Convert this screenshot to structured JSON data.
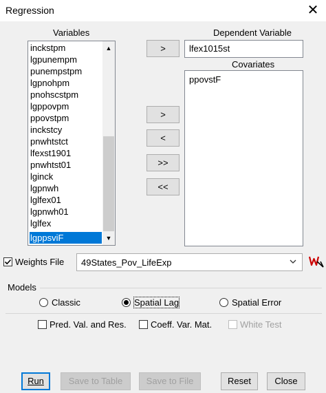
{
  "window": {
    "title": "Regression",
    "close_glyph": "✕"
  },
  "variables": {
    "label": "Variables",
    "items": [
      "inckstpm",
      "lgpunempm",
      "punempstpm",
      "lgpnohpm",
      "pnohscstpm",
      "lgppovpm",
      "ppovstpm",
      "inckstcy",
      "pnwhtstct",
      "lfexst1901",
      "pnwhtst01",
      "lginck",
      "lgpnwh",
      "lglfex01",
      "lgpnwh01",
      "lglfex",
      "lgppsviF"
    ],
    "selected": "lgppsviF"
  },
  "dependent": {
    "label": "Dependent Variable",
    "value": "lfex1015st"
  },
  "covariates": {
    "label": "Covariates",
    "items": [
      "ppovstF"
    ]
  },
  "buttons": {
    "add_dependent": ">",
    "add_covariate": ">",
    "remove_covariate": "<",
    "add_all": ">>",
    "remove_all": "<<",
    "run": "Run",
    "save_table": "Save to Table",
    "save_file": "Save to File",
    "reset": "Reset",
    "close": "Close"
  },
  "weights": {
    "label": "Weights File",
    "checked": true,
    "value": "49States_Pov_LifeExp",
    "icon": "weights-file-icon"
  },
  "models": {
    "label": "Models",
    "options": [
      "Classic",
      "Spatial Lag",
      "Spatial Error"
    ],
    "selected": "Spatial Lag"
  },
  "output_options": {
    "pred": "Pred. Val. and Res.",
    "coeff": "Coeff. Var. Mat.",
    "white": "White Test"
  },
  "colors": {
    "selection": "#0078d7",
    "weights_icon": "#cc0000"
  }
}
